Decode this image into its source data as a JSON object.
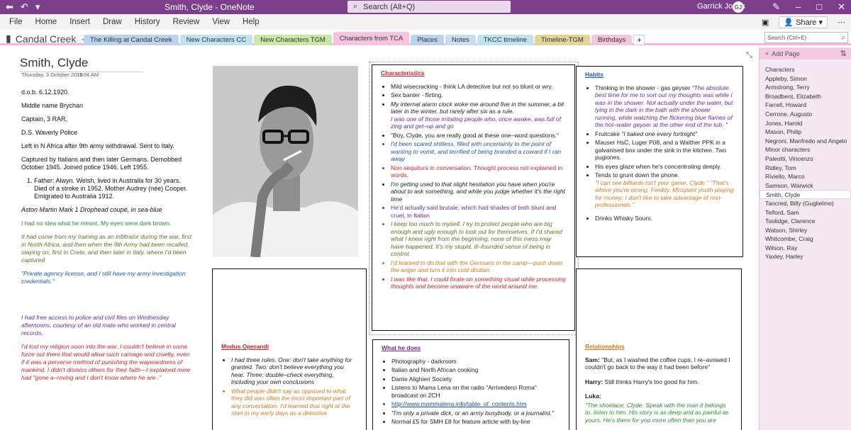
{
  "titlebar": {
    "title": "Smith, Clyde  -  OneNote",
    "search_placeholder": "Search (Alt+Q)",
    "user_name": "Garrick Jones",
    "user_initials": "GJ"
  },
  "ribbon": {
    "menu": [
      "File",
      "Home",
      "Insert",
      "Draw",
      "History",
      "Review",
      "View",
      "Help"
    ],
    "share_label": "Share"
  },
  "notebook": {
    "name": "Candal Creek",
    "tabs": [
      {
        "label": "The Killing at Candal Creek",
        "color": "#bcd3ee"
      },
      {
        "label": "New Characters CC",
        "color": "#bfe3f2"
      },
      {
        "label": "New Characters TGM",
        "color": "#cde6a8"
      },
      {
        "label": "Characters from TCA",
        "color": "#f6c4df",
        "active": true
      },
      {
        "label": "Places",
        "color": "#bcd3ee"
      },
      {
        "label": "Notes",
        "color": "#c9dcf0"
      },
      {
        "label": "TKCC timeline",
        "color": "#bfe3f2"
      },
      {
        "label": "Timeline-TGM",
        "color": "#e2d49a"
      },
      {
        "label": "Birthdays",
        "color": "#f4c6dd"
      }
    ],
    "add_tab": "+",
    "search_placeholder": "Search (Ctrl+E)"
  },
  "pagelist": {
    "add_label": "Add Page",
    "items": [
      "Characters",
      "Appleby, Simon",
      "Armstrong, Terry",
      "Broadbent, Elizabeth",
      "Farrell, Howard",
      "Cerrone, Augusto",
      "Jones, Harold",
      "Mason, Philip",
      "Negroni, Manfredo and Angelo",
      "Minor characters",
      "Paleotti, Vincenzo",
      "Ridley, Tom",
      "Riviello, Marco",
      "Samson, Warwick",
      "Smith, Clyde",
      "Tancred, Billy (Guglielmo)",
      "Telford, Sam",
      "Toolidge, Clarence",
      "Watson, Shirley",
      "Whitcombe, Craig",
      "Wilson, Ray",
      "Yaxley, Harley"
    ],
    "selected_index": 14
  },
  "page": {
    "title": "Smith, Clyde",
    "date": "Thursday, 3 October 2019",
    "time": "11:04 AM",
    "dob": "d.o.b. 6.12.1920.",
    "middle_name": "Middle name Brychan",
    "rank": "Captain, 3 RAR,",
    "police": "D.S. Waverly Police",
    "africa": "Left in N Africa after 9th army withdrawal. Sent to Italy.",
    "captured": "Captured by Italians and then later Germans. Demobbed October 1945. Joined police 1946. Left 1955.",
    "father": "Father: Alwyn. Welsh, lived in Australia for 30 years. Died of a stroke in 1952. Mother Audrey (née) Cooper. Emigrated to Australia 1912.",
    "car": "Aston Martin Mark 1 Drophead coupé, in sea-blue",
    "eyes": "I had no idea what he meant. My eyes were dark brown.",
    "infiltrator": "It had come from my training as an infiltrator during the war, first in North Africa, and then when the 9th Army had been recalled, staying on, first in Crete, and then later in Italy, where I'd been captured",
    "license": "\"Private agency license, and I still have my army investigation credentials.\"",
    "files": " I had free access to police and civil files on Wednesday afternoons, courtesy of an old mate who worked in central records,",
    "religion": "I'd lost my religion soon into the war. I couldn't believe in some force out there that would allow such carnage and cruelty, even if it was a perverse method of punishing the waywardness of mankind. I didn't dismiss others for their faith—I explained mine had \"gone a–roving and I don't know where he are .\""
  },
  "characteristics": {
    "heading": "Characteristics",
    "items": [
      {
        "text": "Mild wisecracking - think LA detective but not so blunt or wry.",
        "style": "plain"
      },
      {
        "text": "Sex banter - flirting.",
        "style": "plain"
      },
      {
        "text": "My internal alarm clock woke me around five in the summer, a bit later in the winter, but rarely after six as a rule.",
        "style": "plain-ital"
      },
      {
        "text": "I was one of those irritating people who, once awake, was full of zing and get–up and go",
        "style": "purple-sub"
      },
      {
        "text": "\"Boy, Clyde, you are really good at these one–word questions.\"",
        "style": "plain"
      },
      {
        "text": "I'd been scared shitless, filled with uncertainty to the point of wanting to vomit, and terrified of being branded a coward if I ran away",
        "style": "blue"
      },
      {
        "text": "Non-sequiturs in conversation. Thought process not explained in words.",
        "style": "redplain"
      },
      {
        "text": "I'm getting used to that slight hesitation you have when you're about to ask something, and while you judge whether it's the right time",
        "style": "plain-ital"
      },
      {
        "text": "He'd actually said brutale, which had shades of both blunt and cruel, in Italian",
        "style": "purple"
      },
      {
        "text": "I keep too much to myself. I try to protect people who are big enough and ugly enough to look out for themselves. If I'd shared what I knew right from the beginning, none of this mess may have happened. It's my stupid, ill–founded sense of being in control.",
        "style": "olive"
      },
      {
        "text": "I'd learned to do that with the Germans in the camp—push down the anger and turn it into cold disdain",
        "style": "orange"
      },
      {
        "text": "I was like that. I could fixate on something visual while processing thoughts and become unaware of the world around me.",
        "style": "red"
      }
    ]
  },
  "habits": {
    "heading": "Habits",
    "items": [
      {
        "main": "Thinking in the shower - gas geyser ",
        "sub": "\"The absolute best time for me to sort out my thoughts was while I was in the shower. Not actually under the water, but lying in the dark in the bath with the shower running, while watching the flickering blue flames of the hot–water geyser at the other end of the tub. \"",
        "substyle": "purple"
      },
      {
        "main": "Fruitcake ",
        "sub": "\"I baked one every fortnight\"",
        "substyle": "plain-ital"
      },
      {
        "main": "Mauser HsC, Luger P08, and a Walther PPK in a galvanised box under the sink in the kitchen. Two pugiones.",
        "sub": "",
        "substyle": ""
      },
      {
        "main": "His eyes glaze when he's concentrating deeply.",
        "sub": "",
        "substyle": ""
      },
      {
        "main": "Tends to grunt down the phone.",
        "sub": "\"I can see billiards isn't your game, Clyde.\" \"That's where you're wrong, Freddy. Misspent youth playing for money; I don't like to take advantage of non-professionals.\"",
        "substyle": "orange"
      },
      {
        "main": "Drinks Whisky Sours.",
        "sub": "",
        "substyle": ""
      }
    ]
  },
  "modus": {
    "heading": "Modus Operandi",
    "items": [
      {
        "text": "I had three rules. One: don't take anything for granted. Two: don't believe everything you hear. Three: double–check everything, including your own conclusions",
        "style": "plain-ital"
      },
      {
        "text": "What people didn't say as opposed to what they did was often the most important part of any conversation. I'd learned that right at the start in my early days as a detective.",
        "style": "orange"
      }
    ]
  },
  "whathedoes": {
    "heading": "What he does",
    "items": [
      "Photography - darkroom",
      "Italian and North African cooking",
      "Dante Alighieri Society",
      "Listens to Mama Lena on the radio \"Arrivederci Roma\" broadcast on 2CH",
      "http://www.mammalena.info/table_of_contents.htm",
      "\"I'm only a private dick, or an army busybody, or a journalist.\"",
      "Normal £5 for SMH £8 for feature article with by-line"
    ]
  },
  "relationships": {
    "heading": "Relationships",
    "sam_label": "Sam:",
    "sam_text": "\"But, as I washed the coffee cups, I re–avowed I couldn't go back to the way it had been before\"",
    "harry_label": "Harry:",
    "harry_text": "Still thinks Harry's too good for him.",
    "luka_label": "Luka:",
    "luka_text": "\"The shoelace, Clyde. Speak with the man it belongs to. listen to him. His story is as deep and as painful as yours. He's there for you more often than you are"
  },
  "colors": {
    "titlebar": "#7b3f8c",
    "pagelist_bg": "#f6e8f2",
    "accent_pink": "#f2b8dc"
  }
}
